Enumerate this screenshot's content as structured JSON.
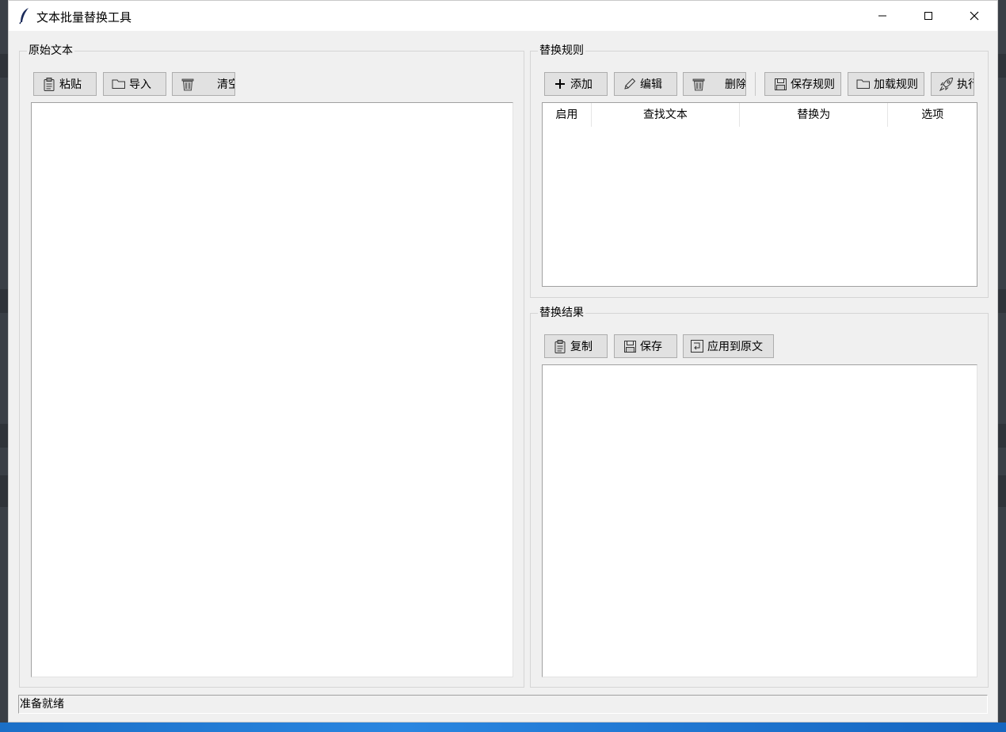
{
  "window": {
    "title": "文本批量替换工具"
  },
  "left_panel": {
    "label": "原始文本",
    "buttons": {
      "paste": "粘贴",
      "import": "导入",
      "clear": "清空"
    }
  },
  "rules_panel": {
    "label": "替换规则",
    "buttons": {
      "add": "添加",
      "edit": "编辑",
      "delete": "删除",
      "save_rules": "保存规则",
      "load_rules": "加载规则",
      "execute": "执行"
    },
    "columns": [
      "启用",
      "查找文本",
      "替换为",
      "选项"
    ]
  },
  "result_panel": {
    "label": "替换结果",
    "buttons": {
      "copy": "复制",
      "save": "保存",
      "apply": "应用到原文"
    }
  },
  "status": "准备就绪"
}
